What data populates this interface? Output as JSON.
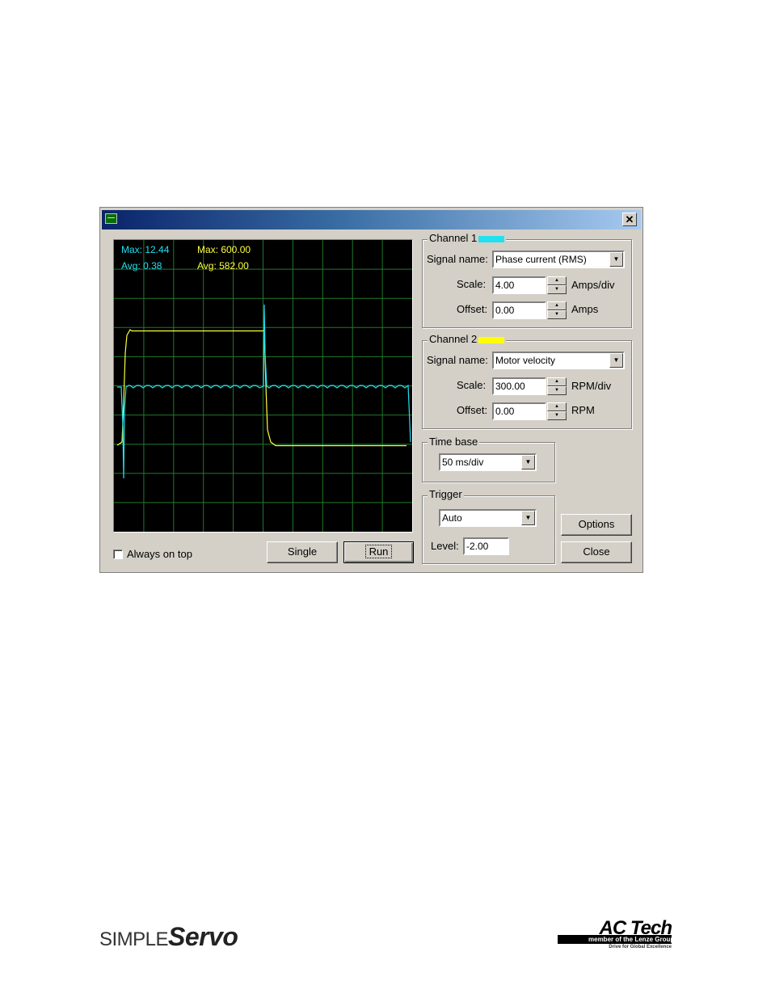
{
  "scope": {
    "ch1_max": "Max: 12.44",
    "ch1_avg": "Avg: 0.38",
    "ch2_max": "Max: 600.00",
    "ch2_avg": "Avg: 582.00"
  },
  "channel1": {
    "title": "Channel 1",
    "color": "#22e0f0",
    "signal_label": "Signal name:",
    "signal_value": "Phase current (RMS)",
    "scale_label": "Scale:",
    "scale_value": "4.00",
    "scale_unit": "Amps/div",
    "offset_label": "Offset:",
    "offset_value": "0.00",
    "offset_unit": "Amps"
  },
  "channel2": {
    "title": "Channel 2",
    "color": "#ffff00",
    "signal_label": "Signal name:",
    "signal_value": "Motor velocity",
    "scale_label": "Scale:",
    "scale_value": "300.00",
    "scale_unit": "RPM/div",
    "offset_label": "Offset:",
    "offset_value": "0.00",
    "offset_unit": "RPM"
  },
  "timebase": {
    "title": "Time base",
    "value": "50 ms/div"
  },
  "trigger": {
    "title": "Trigger",
    "mode": "Auto",
    "level_label": "Level:",
    "level_value": "-2.00"
  },
  "controls": {
    "always_on_top": "Always on top",
    "single": "Single",
    "run": "Run",
    "options": "Options",
    "close": "Close"
  },
  "footer": {
    "left_logo_simple": "SIMPLE",
    "left_logo_servo": "Servo",
    "right_logo_brand": "AC Tech",
    "right_logo_member": "member of the Lenze Group",
    "right_logo_slogan": "Drive for Global Excellence"
  }
}
